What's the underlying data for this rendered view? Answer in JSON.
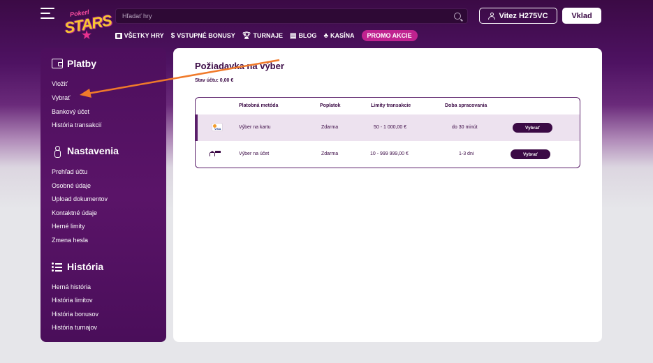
{
  "header": {
    "logo_small": "Pokerl",
    "logo_big": "STARS",
    "search_placeholder": "Hľadať hry",
    "user_label": "Vitez H275VC",
    "deposit_label": "Vklad"
  },
  "topnav": {
    "items": [
      {
        "label": "VŠETKY HRY",
        "icon": "games-icon"
      },
      {
        "label": "VSTUPNÉ BONUSY",
        "icon": "dollar-icon"
      },
      {
        "label": "TURNAJE",
        "icon": "trophy-icon"
      },
      {
        "label": "BLOG",
        "icon": "blog-icon"
      },
      {
        "label": "KASÍNA",
        "icon": "casino-icon"
      }
    ],
    "promo_label": "PROMO AKCIE"
  },
  "sidebar": {
    "sections": [
      {
        "title": "Platby",
        "icon": "wallet-icon",
        "links": [
          "Vložiť",
          "Vybrať",
          "Bankový účet",
          "História transakcií"
        ]
      },
      {
        "title": "Nastavenia",
        "icon": "person-icon",
        "links": [
          "Prehľad účtu",
          "Osobné údaje",
          "Upload dokumentov",
          "Kontaktné údaje",
          "Herné limity",
          "Zmena hesla"
        ]
      },
      {
        "title": "História",
        "icon": "list-icon",
        "links": [
          "Herná história",
          "História limitov",
          "História bonusov",
          "História turnajov"
        ]
      }
    ]
  },
  "main": {
    "title": "Požiadavka na výber",
    "balance": "Stav účtu: 0,00 €",
    "columns": [
      "Platobná metóda",
      "Poplatok",
      "Limity transakcie",
      "Doba spracovania"
    ],
    "rows": [
      {
        "icon": "visa-card-icon",
        "method": "Výber na kartu",
        "fee": "Zdarma",
        "limits": "50 - 1 000,00 €",
        "time": "do 30 minút",
        "button": "Vybrať"
      },
      {
        "icon": "bank-icon",
        "method": "Výber na účet",
        "fee": "Zdarma",
        "limits": "10 - 999 999,00 €",
        "time": "1-3 dni",
        "button": "Vybrať"
      }
    ]
  },
  "colors": {
    "brand_dark": "#3b0a45",
    "sidebar": "#5a1468",
    "promo": "#c0228f",
    "annotation_arrow": "#f07a2a"
  }
}
